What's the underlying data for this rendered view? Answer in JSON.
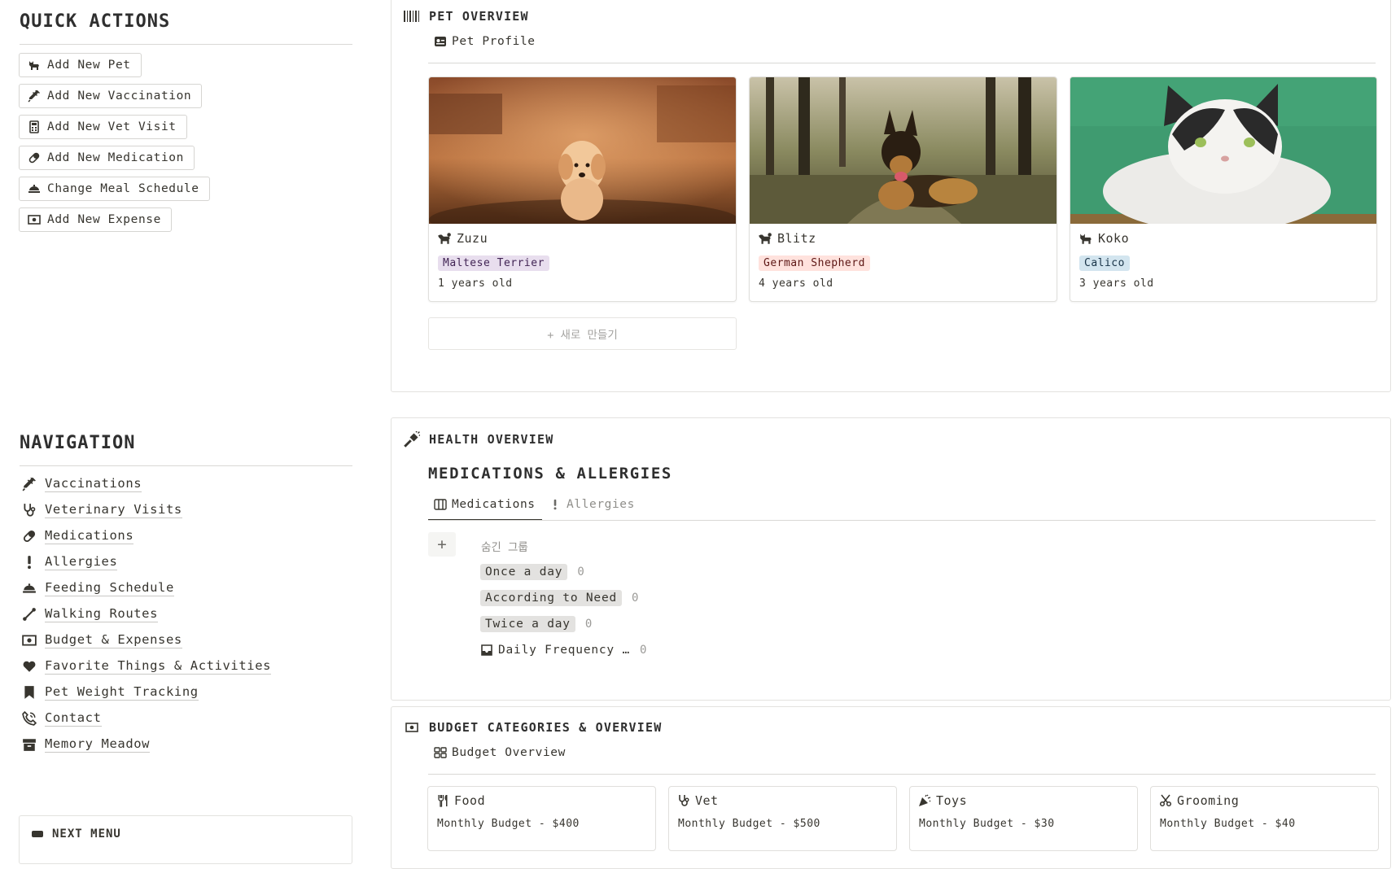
{
  "quick_actions": {
    "title": "QUICK ACTIONS",
    "buttons": [
      {
        "label": "Add New Pet",
        "icon": "cat-icon"
      },
      {
        "label": "Add New Vaccination",
        "icon": "syringe-icon"
      },
      {
        "label": "Add New Vet Visit",
        "icon": "calculator-icon"
      },
      {
        "label": "Add New Medication",
        "icon": "pill-icon"
      },
      {
        "label": "Change Meal Schedule",
        "icon": "food-tray-icon"
      },
      {
        "label": "Add New Expense",
        "icon": "money-icon"
      }
    ]
  },
  "navigation": {
    "title": "NAVIGATION",
    "items": [
      {
        "label": "Vaccinations",
        "icon": "syringe-icon"
      },
      {
        "label": "Veterinary Visits",
        "icon": "stethoscope-icon"
      },
      {
        "label": "Medications",
        "icon": "pill-icon"
      },
      {
        "label": "Allergies",
        "icon": "exclamation-icon"
      },
      {
        "label": "Feeding Schedule",
        "icon": "food-tray-icon"
      },
      {
        "label": "Walking Routes",
        "icon": "route-icon"
      },
      {
        "label": "Budget & Expenses",
        "icon": "money-icon"
      },
      {
        "label": "Favorite Things & Activities",
        "icon": "heart-icon"
      },
      {
        "label": "Pet Weight Tracking",
        "icon": "bookmark-icon"
      },
      {
        "label": "Contact",
        "icon": "phone-icon"
      },
      {
        "label": "Memory Meadow",
        "icon": "archive-icon"
      }
    ],
    "next_menu": "NEXT MENU"
  },
  "pet_overview": {
    "title": "PET OVERVIEW",
    "view_label": "Pet Profile",
    "new_button": "+ 새로 만들기",
    "pets": [
      {
        "name": "Zuzu",
        "breed": "Maltese Terrier",
        "age": "1 years old",
        "tag_bg": "#e8deee",
        "tag_fg": "#412454",
        "photo": "golden-puppy-photo"
      },
      {
        "name": "Blitz",
        "breed": "German Shepherd",
        "age": "4 years old",
        "tag_bg": "#ffe2dd",
        "tag_fg": "#5d1715",
        "photo": "german-shepherd-photo"
      },
      {
        "name": "Koko",
        "breed": "Calico",
        "age": "3 years old",
        "tag_bg": "#d3e5ef",
        "tag_fg": "#183347",
        "photo": "calico-cat-photo"
      }
    ]
  },
  "health_overview": {
    "title": "HEALTH OVERVIEW",
    "subtitle": "MEDICATIONS & ALLERGIES",
    "tabs": [
      {
        "label": "Medications",
        "active": true,
        "icon": "table-icon"
      },
      {
        "label": "Allergies",
        "active": false,
        "icon": "exclamation-icon"
      }
    ],
    "hidden_groups_label": "숨긴 그룹",
    "add_symbol": "+",
    "groups": [
      {
        "label": "Once a day",
        "count": "0"
      },
      {
        "label": "According to Need",
        "count": "0"
      },
      {
        "label": "Twice a day",
        "count": "0"
      },
      {
        "label": "Daily Frequency …",
        "count": "0"
      }
    ]
  },
  "budget": {
    "title": "BUDGET CATEGORIES & OVERVIEW",
    "view_label": "Budget Overview",
    "categories": [
      {
        "name": "Food",
        "monthly": "Monthly Budget - $400",
        "icon": "utensils-icon"
      },
      {
        "name": "Vet",
        "monthly": "Monthly Budget - $500",
        "icon": "stethoscope-icon"
      },
      {
        "name": "Toys",
        "monthly": "Monthly Budget - $30",
        "icon": "party-icon"
      },
      {
        "name": "Grooming",
        "monthly": "Monthly Budget - $40",
        "icon": "scissors-icon"
      }
    ]
  }
}
